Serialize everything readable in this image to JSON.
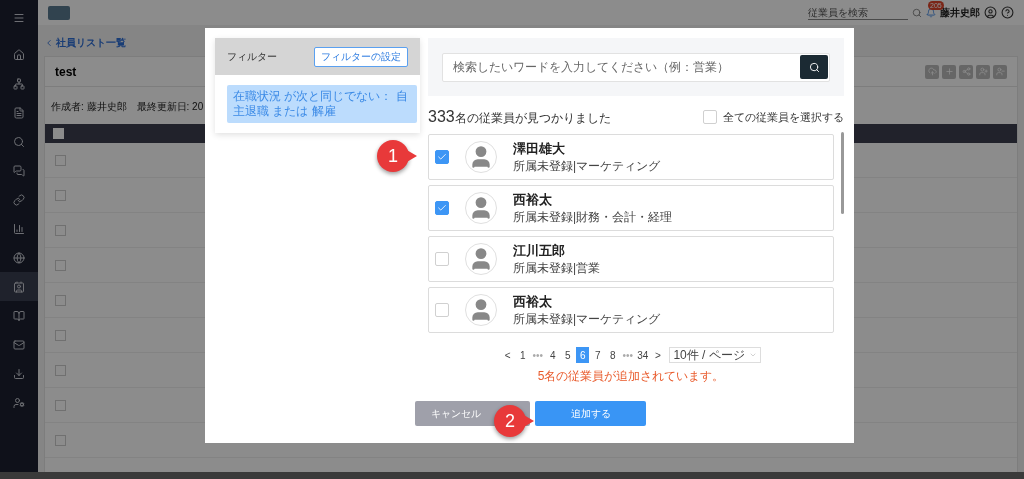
{
  "sidebar": {
    "items": [
      {
        "kind": "menu",
        "selected": false
      },
      {
        "kind": "home",
        "selected": false
      },
      {
        "kind": "org",
        "selected": false
      },
      {
        "kind": "file",
        "selected": false
      },
      {
        "kind": "search",
        "selected": false
      },
      {
        "kind": "chat",
        "selected": false
      },
      {
        "kind": "link",
        "selected": false
      },
      {
        "kind": "chart",
        "selected": false
      },
      {
        "kind": "globe",
        "selected": false
      },
      {
        "kind": "contact",
        "selected": true
      },
      {
        "kind": "book",
        "selected": false
      },
      {
        "kind": "mail",
        "selected": false
      },
      {
        "kind": "download",
        "selected": false
      },
      {
        "kind": "usercog",
        "selected": false
      }
    ]
  },
  "header": {
    "search_placeholder": "従業員を検索",
    "notification_count": "205",
    "user_name": "藤井史郎"
  },
  "page": {
    "back_link": "社員リスト一覧",
    "card_title": "test",
    "meta": "作成者: 藤井史郎　最終更新日: 20",
    "header_checked": false,
    "rows": [
      {
        "checked": false
      },
      {
        "checked": false
      },
      {
        "checked": false
      },
      {
        "checked": false
      },
      {
        "checked": false
      },
      {
        "checked": false
      },
      {
        "checked": false
      },
      {
        "checked": false
      },
      {
        "checked": false
      }
    ]
  },
  "dialog": {
    "filter": {
      "title": "フィルター",
      "settings_button": "フィルターの設定",
      "conditions": [
        "在職状況 が次と同じでない： 自主退職 または 解雇"
      ]
    },
    "search": {
      "placeholder": "検索したいワードを入力してください（例：営業）"
    },
    "count": "333",
    "count_suffix": "名の従業員が見つかりました",
    "select_all": {
      "label": "全ての従業員を選択する",
      "checked": false
    },
    "employees": [
      {
        "name": "澤田雄大",
        "department": "所属未登録|マーケティング",
        "checked": true
      },
      {
        "name": "西裕太",
        "department": "所属未登録|財務・会計・経理",
        "checked": true
      },
      {
        "name": "江川五郎",
        "department": "所属未登録|営業",
        "checked": false
      },
      {
        "name": "西裕太",
        "department": "所属未登録|マーケティング",
        "checked": false
      }
    ],
    "pagination": [
      {
        "label": "<",
        "kind": "arrow",
        "selected": false
      },
      {
        "label": "1",
        "kind": "page",
        "selected": false
      },
      {
        "label": "•••",
        "kind": "ellipsis",
        "selected": false
      },
      {
        "label": "4",
        "kind": "page",
        "selected": false
      },
      {
        "label": "5",
        "kind": "page",
        "selected": false
      },
      {
        "label": "6",
        "kind": "page",
        "selected": true
      },
      {
        "label": "7",
        "kind": "page",
        "selected": false
      },
      {
        "label": "8",
        "kind": "page",
        "selected": false
      },
      {
        "label": "•••",
        "kind": "ellipsis",
        "selected": false
      },
      {
        "label": "34",
        "kind": "page",
        "selected": false
      },
      {
        "label": ">",
        "kind": "arrow",
        "selected": false
      }
    ],
    "page_size": "10件 / ページ",
    "message": "5名の従業員が追加されています。",
    "cancel_button": "キャンセル",
    "add_button": "追加する"
  },
  "callouts": [
    "1",
    "2"
  ]
}
